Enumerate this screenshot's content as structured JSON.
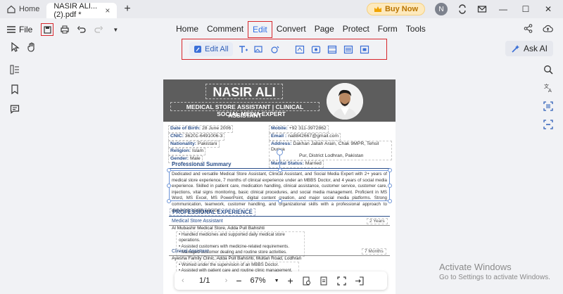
{
  "titlebar": {
    "home_label": "Home",
    "doc_tab": "NASIR ALI...(2).pdf *",
    "buy_now": "Buy Now",
    "avatar_initial": "N"
  },
  "menubar": {
    "file_label": "File",
    "menus": [
      "Home",
      "Comment",
      "Edit",
      "Convert",
      "Page",
      "Protect",
      "Form",
      "Tools"
    ],
    "active_menu": "Edit"
  },
  "edit_toolbar": {
    "edit_all": "Edit All"
  },
  "ask_ai": "Ask AI",
  "resume": {
    "name": "NASIR ALI",
    "subtitle1": "MEDICAL STORE ASSISTANT | CLINICAL ASSISTANT",
    "subtitle2": "SOCIAL MEDIA EXPERT",
    "dob_label": "Date of Birth:",
    "dob": "28 June 2006",
    "cnic_label": "CNIC:",
    "cnic": "36201-6491006-3",
    "nationality_label": "Nationality:",
    "nationality": "Pakistani",
    "religion_label": "Religion:",
    "religion": "Islam",
    "gender_label": "Gender:",
    "gender": "Male",
    "mobile_label": "Mobile:",
    "mobile": "+92 311-3972862",
    "email_label": "Email :",
    "email": "na8842667@gmail.com",
    "address_label": "Address:",
    "address1": "Dakhan Jallah Arain, Chak 9MPR, Tehsil Dunya",
    "address2": "Pur, District Lodhran, Pakistan",
    "marital_label": "Marital Status:",
    "marital": "Married",
    "summary_title": "Professional Summary",
    "summary_text": "Dedicated and versatile Medical Store Assistant, Clinical Assistant, and Social Media Expert with 2+ years of medical store experience, 7 months of clinical experience under an MBBS Doctor, and 4 years of social media experience. Skilled in patient care, medication handling, clinical assistance, customer service, customer care, injections, vital signs monitoring, basic clinical procedures, and social media management. Proficient in MS Word, MS Excel, MS PowerPoint, digital content creation, and major social media platforms. Strong communication, teamwork, customer handling, and organizational skills with a professional approach to delivering quality service.",
    "experience_title": "PROFESSIONAL EXPERIENCE",
    "job1_title": "Medical Store Assistant",
    "job1_duration": "2 Years",
    "job1_company": "Al Mubashir Medical Store, Adda Pull Bahishti",
    "job1_bullets": [
      "Handled medicines and supported daily medical store operations.",
      "Assisted customers with medicine-related requirements.",
      "Managed customer dealing and routine store activities."
    ],
    "job2_title": "Clinical Assistant",
    "job2_duration": "7 Months",
    "job2_company": "Ayesha Family Clinic, Adda Pull Bahishti, Multan Road, Lodhran",
    "job2_bullets": [
      "Worked under the supervision of an MBBS Doctor.",
      "Assisted with patient care and routine clinic management."
    ]
  },
  "bottom_nav": {
    "page": "1/1",
    "zoom": "67%"
  },
  "watermark": {
    "line1": "Activate Windows",
    "line2": "Go to Settings to activate Windows."
  },
  "colors": {
    "accent": "#2f6fe6",
    "highlight_red": "#d7262b",
    "header_gray": "#5d5d5d",
    "resume_blue": "#2a4f8a"
  }
}
